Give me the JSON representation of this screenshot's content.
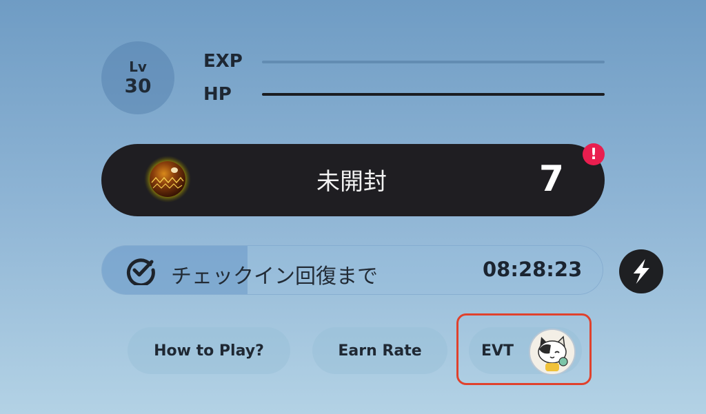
{
  "level": {
    "label": "Lv",
    "value": "30"
  },
  "stats": {
    "exp": {
      "label": "EXP",
      "fraction": 0.0
    },
    "hp": {
      "label": "HP",
      "fraction": 1.0
    }
  },
  "pack": {
    "title": "未開封",
    "count": "7",
    "alert": "!"
  },
  "checkin": {
    "label": "チェックイン回復まで",
    "timer": "08:28:23",
    "progress": 0.29
  },
  "buttons": {
    "how_to_play": "How to Play?",
    "earn_rate": "Earn Rate",
    "evt": "EVT"
  },
  "colors": {
    "highlight": "#e0412c",
    "alert": "#e91e4f",
    "dark_panel": "#1f1e22"
  }
}
